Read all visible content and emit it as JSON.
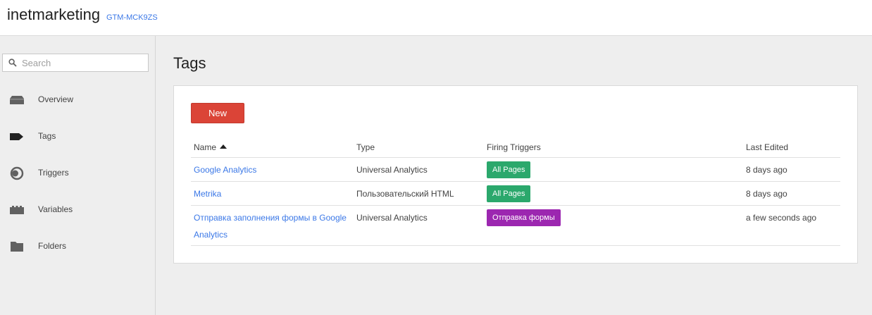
{
  "header": {
    "account_name": "inetmarketing",
    "container_id": "GTM-MCK9ZS"
  },
  "sidebar": {
    "search": {
      "placeholder": "Search",
      "value": "",
      "icon": "search-icon"
    },
    "items": [
      {
        "label": "Overview",
        "icon": "overview-icon",
        "active": false
      },
      {
        "label": "Tags",
        "icon": "tag-icon",
        "active": true
      },
      {
        "label": "Triggers",
        "icon": "trigger-icon",
        "active": false
      },
      {
        "label": "Variables",
        "icon": "variables-icon",
        "active": false
      },
      {
        "label": "Folders",
        "icon": "folder-icon",
        "active": false
      }
    ]
  },
  "main": {
    "title": "Tags",
    "new_button_label": "New",
    "table": {
      "headers": {
        "name": "Name",
        "type": "Type",
        "firing_triggers": "Firing Triggers",
        "last_edited": "Last Edited"
      },
      "sort": {
        "column": "name",
        "direction": "ascending"
      },
      "rows": [
        {
          "name": "Google Analytics",
          "type": "Universal Analytics",
          "trigger": "All Pages",
          "trigger_color": "#2ba86c",
          "last_edited": "8 days ago"
        },
        {
          "name": "Metrika",
          "type": "Пользовательский HTML",
          "trigger": "All Pages",
          "trigger_color": "#2ba86c",
          "last_edited": "8 days ago"
        },
        {
          "name_line1": "Отправка заполнения формы в Google",
          "name_line2": "Analytics",
          "type": "Universal Analytics",
          "trigger": "Отправка формы",
          "trigger_color": "#9c27b0",
          "last_edited": "a few seconds ago"
        }
      ]
    }
  },
  "colors": {
    "accent_link": "#3b78e7",
    "new_button": "#db4437",
    "badge_green": "#2ba86c",
    "badge_purple": "#9c27b0"
  }
}
